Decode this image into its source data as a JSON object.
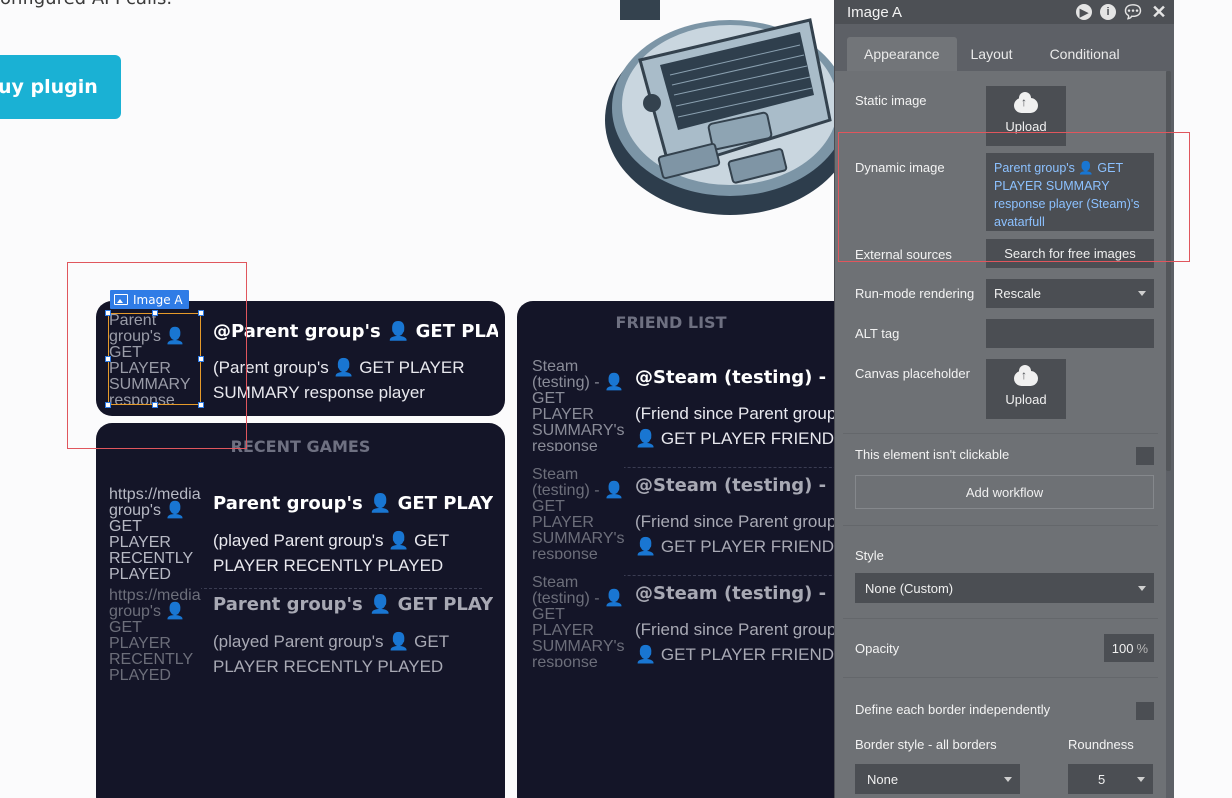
{
  "page": {
    "intro_text": "onfigured API calls.",
    "buy_button": "uy plugin"
  },
  "element_tag": {
    "label": "Image A"
  },
  "player_card": {
    "thumb_text": "Parent group's 👤 GET PLAYER SUMMARY response",
    "title": "@Parent group's 👤 GET PLAYER SUMMARY",
    "subtitle": "(Parent group's 👤 GET PLAYER SUMMARY response player"
  },
  "recent_games": {
    "title": "RECENT GAMES",
    "rows": [
      {
        "thumb_text": "https://media group's 👤 GET PLAYER RECENTLY PLAYED",
        "title": "Parent group's 👤 GET PLAYER RECENTLY PLAYED GAME",
        "subtitle": "(played Parent group's 👤 GET PLAYER RECENTLY PLAYED"
      },
      {
        "thumb_text": "https://media group's 👤 GET PLAYER RECENTLY PLAYED",
        "title": "Parent group's 👤 GET PLAYER RECENTLY PLAYED GAME",
        "subtitle": "(played Parent group's 👤 GET PLAYER RECENTLY PLAYED"
      }
    ]
  },
  "friend_list": {
    "title": "FRIEND LIST",
    "rows": [
      {
        "thumb_text": "Steam (testing) - 👤 GET PLAYER SUMMARY's response",
        "title": "@Steam (testing) - 👤 GET PLAYER SUMMARY",
        "subtitle": "(Friend since  Parent group's 👤 GET PLAYER FRIEND LIST friend"
      },
      {
        "thumb_text": "Steam (testing) - 👤 GET PLAYER SUMMARY's response",
        "title": "@Steam (testing) - 👤 GET PLAYER SUMMARY",
        "subtitle": "(Friend since  Parent group's 👤 GET PLAYER FRIEND LIST friend"
      },
      {
        "thumb_text": "Steam (testing) - 👤 GET PLAYER SUMMARY's response",
        "title": "@Steam (testing) - 👤 GET PLAYER SUMMARY",
        "subtitle": "(Friend since  Parent group's 👤 GET PLAYER FRIEND LIST friend"
      }
    ]
  },
  "panel": {
    "title": "Image A",
    "header_icons": [
      "play-icon",
      "info-icon",
      "comment-icon",
      "close-icon"
    ],
    "tabs": [
      "Appearance",
      "Layout",
      "Conditional"
    ],
    "active_tab": "Appearance",
    "static_image_label": "Static image",
    "upload_label": "Upload",
    "dynamic_image_label": "Dynamic image",
    "dynamic_image_value": "Parent group's 👤 GET PLAYER SUMMARY response player (Steam)'s avatarfull",
    "external_sources_label": "External sources",
    "search_images_button": "Search for free images",
    "run_mode_label": "Run-mode rendering",
    "run_mode_value": "Rescale",
    "alt_tag_label": "ALT tag",
    "alt_tag_value": "",
    "canvas_placeholder_label": "Canvas placeholder",
    "not_clickable_label": "This element isn't clickable",
    "add_workflow_button": "Add workflow",
    "style_label": "Style",
    "style_value": "None (Custom)",
    "opacity_label": "Opacity",
    "opacity_value": "100",
    "opacity_unit": "%",
    "border_independent_label": "Define each border independently",
    "border_style_label": "Border style - all borders",
    "border_style_value": "None",
    "roundness_label": "Roundness",
    "roundness_value": "5"
  },
  "colors": {
    "card_bg": "#141528",
    "accent_button": "#1ab1d4",
    "selection_blue": "#2f7ce6",
    "highlight_red": "#e0565d",
    "panel_bg": "#6e7175",
    "link_blue": "#8cc1ff"
  }
}
